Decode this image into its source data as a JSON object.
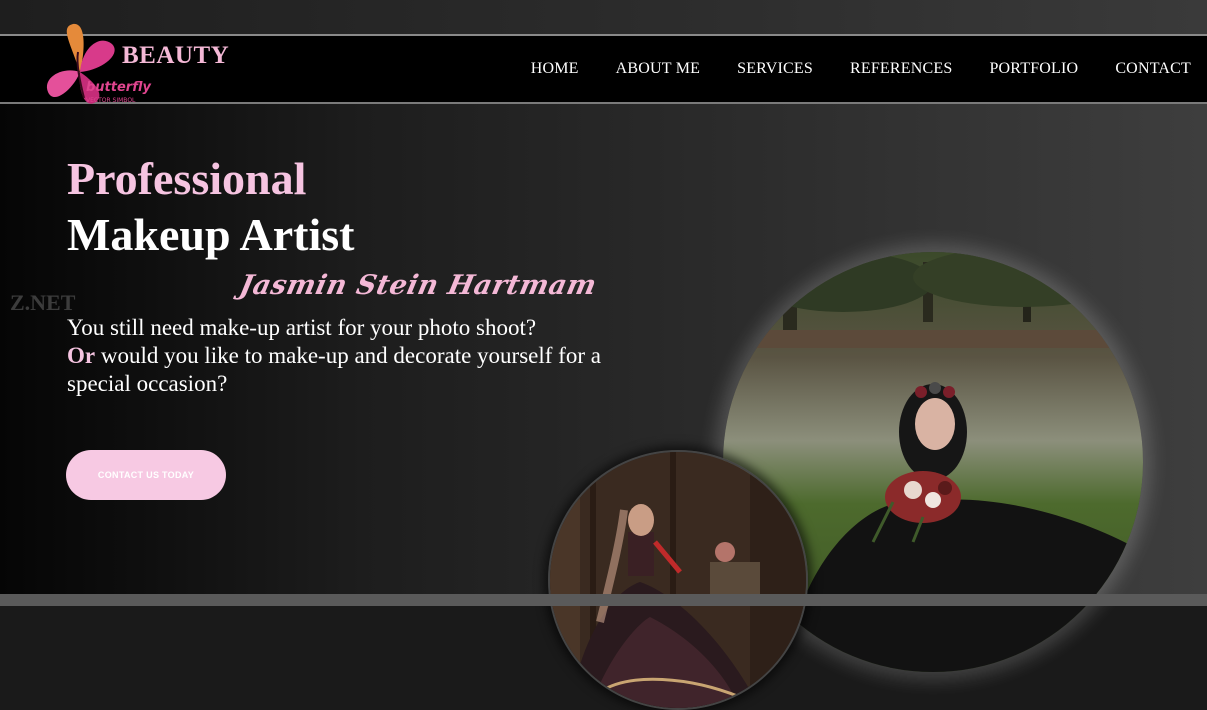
{
  "logo": {
    "brand": "BEAUTY",
    "tagline": "butterfly",
    "small_text": "VECTOR SIMBOL",
    "icon": "butterfly-icon"
  },
  "nav": {
    "items": [
      "HOME",
      "ABOUT ME",
      "SERVICES",
      "REFERENCES",
      "PORTFOLIO",
      "CONTACT"
    ]
  },
  "hero": {
    "title_line1": "Professional",
    "title_line2": "Makeup Artist",
    "signature": "Jasmin Stein Hartmam",
    "ghost_text": "Z.NET",
    "paragraph_part1": "You still need make-up artist for your photo shoot?",
    "paragraph_or": "Or",
    "paragraph_part2": "would you like to make-up and decorate yourself for a special occasion?",
    "cta_label": "CONTACT US TODAY"
  },
  "colors": {
    "accent_pink": "#f6c4e1",
    "logo_magenta": "#e0458f",
    "nav_bg": "#000000"
  },
  "images": {
    "large": "photo-woman-black-gown-park",
    "small": "photo-bride-lehenga"
  }
}
